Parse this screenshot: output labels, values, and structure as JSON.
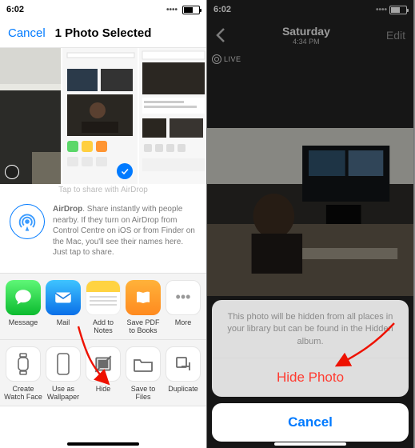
{
  "left": {
    "status_time": "6:02",
    "nav": {
      "cancel": "Cancel",
      "title": "1 Photo Selected"
    },
    "share_hint": "Tap to share with AirDrop",
    "airdrop": {
      "bold": "AirDrop",
      "rest": ". Share instantly with people nearby. If they turn on AirDrop from Control Centre on iOS or from Finder on the Mac, you'll see their names here. Just tap to share."
    },
    "apps": {
      "message": "Message",
      "mail": "Mail",
      "notes": "Add to Notes",
      "books": "Save PDF\nto Books",
      "more": "More"
    },
    "actions": {
      "watch": "Create\nWatch Face",
      "wallpaper": "Use as\nWallpaper",
      "hide": "Hide",
      "files": "Save to Files",
      "duplicate": "Duplicate"
    }
  },
  "right": {
    "status_time": "6:02",
    "nav": {
      "day": "Saturday",
      "time": "4:34 PM",
      "edit": "Edit"
    },
    "live_label": "LIVE",
    "sheet": {
      "message": "This photo will be hidden from all places in your library but can be found in the Hidden album.",
      "hide": "Hide Photo",
      "cancel": "Cancel"
    }
  }
}
